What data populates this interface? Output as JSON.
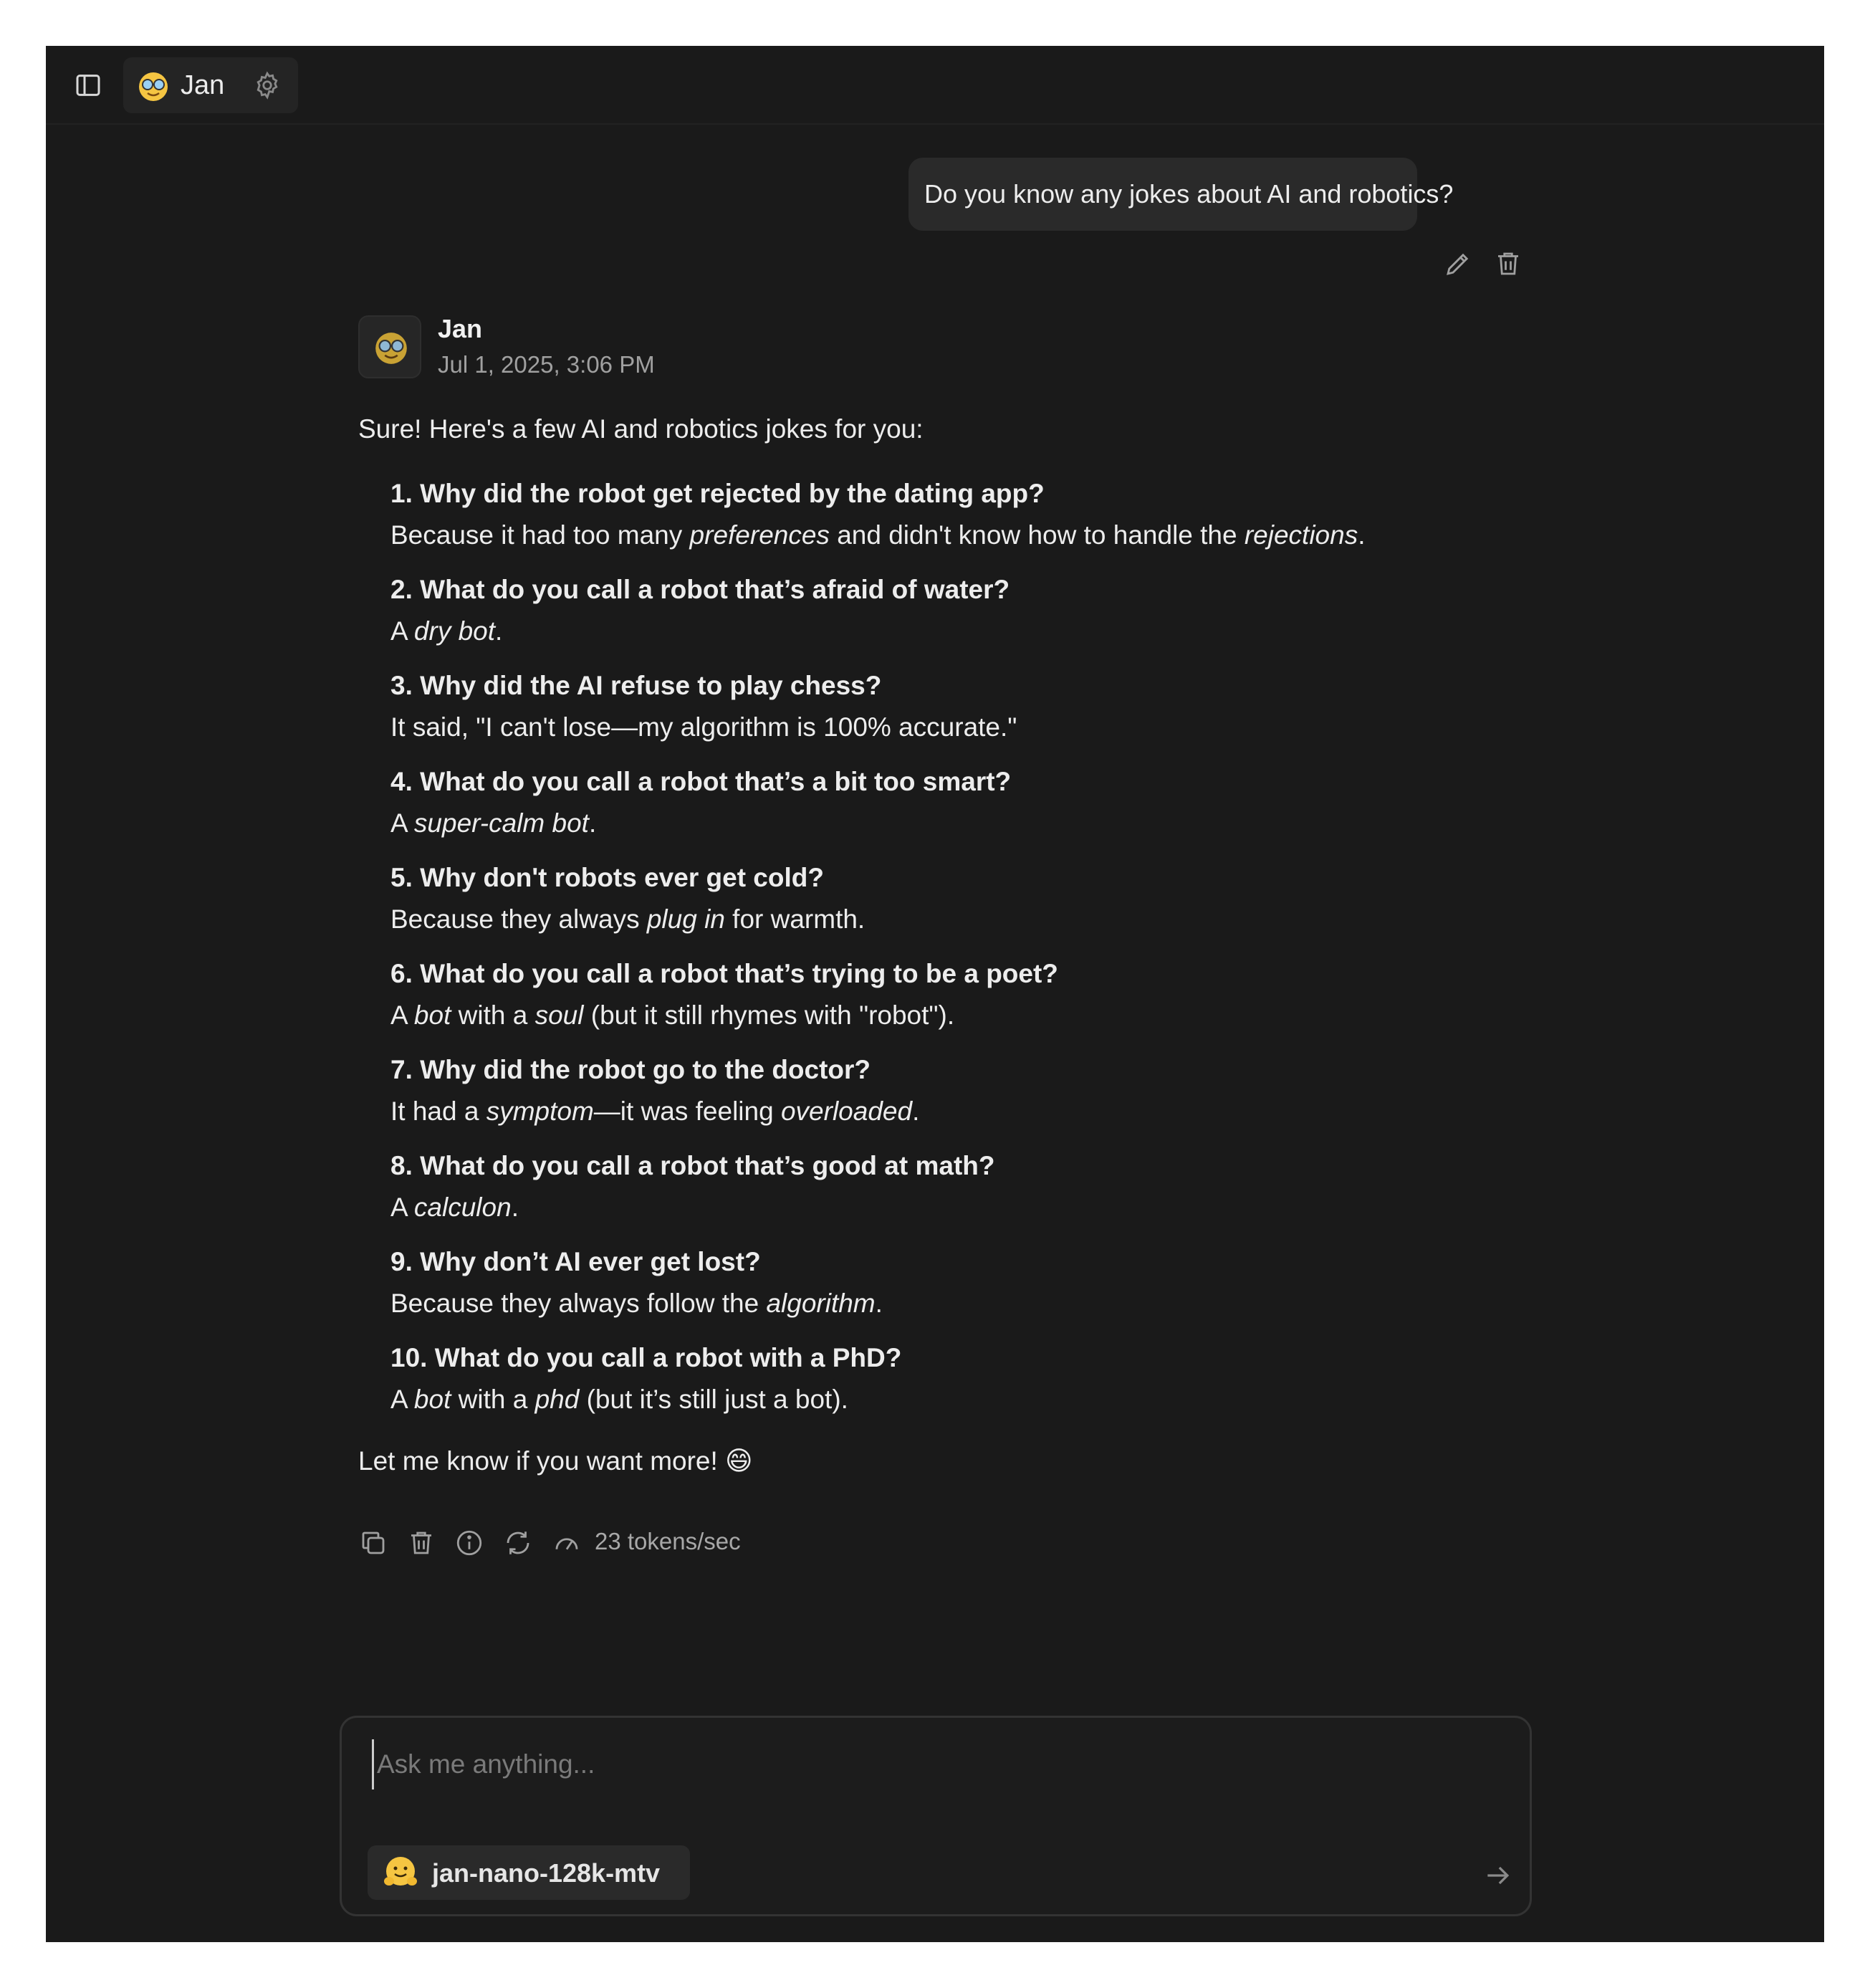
{
  "header": {
    "assistant_name": "Jan",
    "sidebar_toggle_icon": "sidebar-toggle-icon",
    "settings_icon": "gear-icon"
  },
  "user_message": {
    "text": "Do you know any jokes about AI and robotics?"
  },
  "assistant_message": {
    "author": "Jan",
    "timestamp": "Jul 1, 2025, 3:06 PM",
    "intro": "Sure! Here's a few AI and robotics jokes for you:",
    "jokes": [
      {
        "number": "1.",
        "question": "Why did the robot get rejected by the dating app?",
        "answer": [
          "Because it had too many ",
          {
            "i": "preferences"
          },
          " and didn't know how to handle the ",
          {
            "i": "rejections"
          },
          "."
        ]
      },
      {
        "number": "2.",
        "question": "What do you call a robot that’s afraid of water?",
        "answer": [
          "A ",
          {
            "i": "dry bot"
          },
          "."
        ]
      },
      {
        "number": "3.",
        "question": "Why did the AI refuse to play chess?",
        "answer": [
          "It said, \"I can't lose—my algorithm is 100% accurate.\""
        ]
      },
      {
        "number": "4.",
        "question": "What do you call a robot that’s a bit too smart?",
        "answer": [
          "A ",
          {
            "i": "super-calm bot"
          },
          "."
        ]
      },
      {
        "number": "5.",
        "question": "Why don't robots ever get cold?",
        "answer": [
          "Because they always ",
          {
            "i": "plug in"
          },
          " for warmth."
        ]
      },
      {
        "number": "6.",
        "question": "What do you call a robot that’s trying to be a poet?",
        "answer": [
          "A ",
          {
            "i": "bot"
          },
          " with a ",
          {
            "i": "soul"
          },
          " (but it still rhymes with \"robot\")."
        ]
      },
      {
        "number": "7.",
        "question": "Why did the robot go to the doctor?",
        "answer": [
          "It had a ",
          {
            "i": "symptom"
          },
          "—it was feeling ",
          {
            "i": "overloaded"
          },
          "."
        ]
      },
      {
        "number": "8.",
        "question": "What do you call a robot that’s good at math?",
        "answer": [
          "A ",
          {
            "i": "calculon"
          },
          "."
        ]
      },
      {
        "number": "9.",
        "question": "Why don’t AI ever get lost?",
        "answer": [
          "Because they always follow the ",
          {
            "i": "algorithm"
          },
          "."
        ]
      },
      {
        "number": "10.",
        "question": "What do you call a robot with a PhD?",
        "answer": [
          "A ",
          {
            "i": "bot"
          },
          " with a ",
          {
            "i": "phd"
          },
          " (but it’s still just a bot)."
        ]
      }
    ],
    "outro": "Let me know if you want more! 😄",
    "tokens_per_sec": "23 tokens/sec"
  },
  "composer": {
    "placeholder": "Ask me anything...",
    "value": "",
    "model_name": "jan-nano-128k-mtv"
  }
}
